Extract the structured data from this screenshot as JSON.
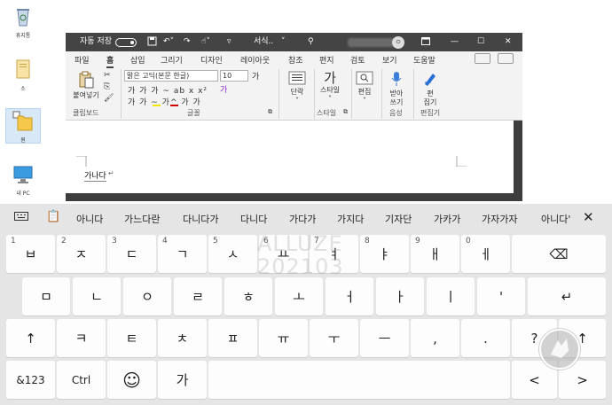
{
  "desktop": {
    "icons": [
      {
        "name": "recycle-bin",
        "label": "휴지통"
      },
      {
        "name": "folder",
        "label": "소"
      },
      {
        "name": "folder-selected",
        "label": "원"
      },
      {
        "name": "this-pc",
        "label": "내 PC"
      }
    ]
  },
  "word": {
    "autosave_label": "자동 저장",
    "doc_title": "서식..",
    "avatar_initial": "ㅇ",
    "tabs": [
      "파일",
      "홈",
      "삽입",
      "그리기",
      "디자인",
      "레이아웃",
      "참조",
      "편지",
      "검토",
      "보기",
      "도움말"
    ],
    "active_tab": "홈",
    "clipboard": {
      "paste_label": "붙여넣기",
      "group": "클립보드"
    },
    "font": {
      "name": "맑은 고딕(본문 한글)",
      "size": "10",
      "group": "글꼴",
      "row1": "가  가  가  ~  ab x  x²",
      "row2": "가  가  ~  가^  가  가"
    },
    "paragraph": {
      "label": "단락"
    },
    "styles": {
      "label": "스타일",
      "group": "스타일"
    },
    "editing": {
      "label": "편집"
    },
    "dictate": {
      "label": "받아\n쓰기",
      "group": "음성"
    },
    "editor": {
      "label": "편\n집기",
      "group": "편집기"
    },
    "document_text": "가나다"
  },
  "keyboard": {
    "suggestions": [
      "아니다",
      "가느다란",
      "다니다가",
      "다니다",
      "가다가",
      "가지다",
      "기자단",
      "가카가",
      "가자가자",
      "아니다'"
    ],
    "row1": [
      {
        "num": "1",
        "key": "ㅂ"
      },
      {
        "num": "2",
        "key": "ㅈ"
      },
      {
        "num": "3",
        "key": "ㄷ"
      },
      {
        "num": "4",
        "key": "ㄱ"
      },
      {
        "num": "5",
        "key": "ㅅ"
      },
      {
        "num": "6",
        "key": "ㅛ"
      },
      {
        "num": "7",
        "key": "ㅕ"
      },
      {
        "num": "8",
        "key": "ㅑ"
      },
      {
        "num": "9",
        "key": "ㅐ"
      },
      {
        "num": "0",
        "key": "ㅔ"
      }
    ],
    "row2": [
      "ㅁ",
      "ㄴ",
      "ㅇ",
      "ㄹ",
      "ㅎ",
      "ㅗ",
      "ㅓ",
      "ㅏ",
      "ㅣ",
      "'"
    ],
    "row3": [
      "ㅋ",
      "ㅌ",
      "ㅊ",
      "ㅍ",
      "ㅠ",
      "ㅜ",
      "ㅡ",
      ",",
      ".",
      "?"
    ],
    "row4": {
      "symbols": "&123",
      "ctrl": "Ctrl",
      "lang": "가"
    },
    "shift": "↑",
    "backspace": "⌫",
    "enter": "↵",
    "left": "<",
    "right": ">",
    "emoji": "☺",
    "close": "✕",
    "watermark": [
      "ALLUZE",
      "202103"
    ]
  }
}
